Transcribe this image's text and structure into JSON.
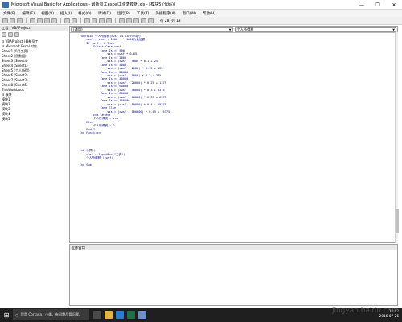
{
  "window": {
    "title": "Microsoft Visual Basic for Applications - 最新员工excel工资表模板.xls - [模块5 (代码)]",
    "controls": [
      "—",
      "❐",
      "✕"
    ]
  },
  "menu": [
    "文件(F)",
    "编辑(E)",
    "视图(V)",
    "插入(I)",
    "格式(O)",
    "调试(D)",
    "运行(R)",
    "工具(T)",
    "外接程序(A)",
    "窗口(W)",
    "帮助(H)"
  ],
  "toolbar": {
    "position": "行 28, 列 13"
  },
  "project": {
    "header": "工程 - VBAProject",
    "tree": [
      "⊟ VBAProject (最新员工",
      "  ⊟ Microsoft Excel 对象",
      "      Sheet1 (0月工资)",
      "      Sheet2 (原数据)",
      "      Sheet3 (Sheet4)",
      "      Sheet4 (Sheet1)",
      "      Sheet5 (个人所得)",
      "      Sheet6 (Sheet2)",
      "      Sheet7 (Sheet3)",
      "      Sheet8 (Sheet5)",
      "      ThisWorkbook",
      "  ⊟ 模块",
      "      模块1",
      "      模块2",
      "      模块3",
      "      模块4",
      "      模块5"
    ]
  },
  "code": {
    "combo_left": "(通用)",
    "combo_right": "个人所得税",
    "lines": [
      "    Function 个人所得税(cwsf As Currency)",
      "        cwsf = cwsf - 1600   ' 1600为免征额",
      "        If cwsf > 0 Then",
      "            Select Case cwsf",
      "                Case Is <= 500",
      "                    sss = cwsf * 0.05",
      "                Case Is <= 2000",
      "                    sss = (cwsf - 500) * 0.1 + 25",
      "                Case Is <= 5000",
      "                    sss = (cwsf - 2000) * 0.15 + 125",
      "                Case Is <= 20000",
      "                    sss = (cwsf - 5000) * 0.2 + 375",
      "                Case Is <= 40000",
      "                    sss = (cwsf - 20000) * 0.25 + 1375",
      "                Case Is <= 60000",
      "                    sss = (cwsf - 40000) * 0.3 + 3375",
      "                Case Is <= 80000",
      "                    sss = (cwsf - 60000) * 0.35 + 6375",
      "                Case Is <= 100000",
      "                    sss = (cwsf - 80000) * 0.4 + 10375",
      "                Case Else",
      "                    sss = (cwsf - 100000) * 0.45 + 15375",
      "            End Select",
      "            个人所得税 = sss",
      "        Else",
      "            个人所得税 = 0",
      "        End If",
      "    End Function",
      "",
      "",
      "",
      "",
      "    Sub 计算()",
      "        cwsf = InputBox(\"工资\")",
      "        个人所得税 (cwsf)",
      "",
      "    End Sub"
    ]
  },
  "immediate": {
    "header": "立即窗口"
  },
  "taskbar": {
    "start": "⊞",
    "search_placeholder": "我是 Cortana，小娜。有问题尽管问我。",
    "time": "10:02",
    "date": "2016-07-26"
  },
  "watermark": "jingyan.baidu.com"
}
